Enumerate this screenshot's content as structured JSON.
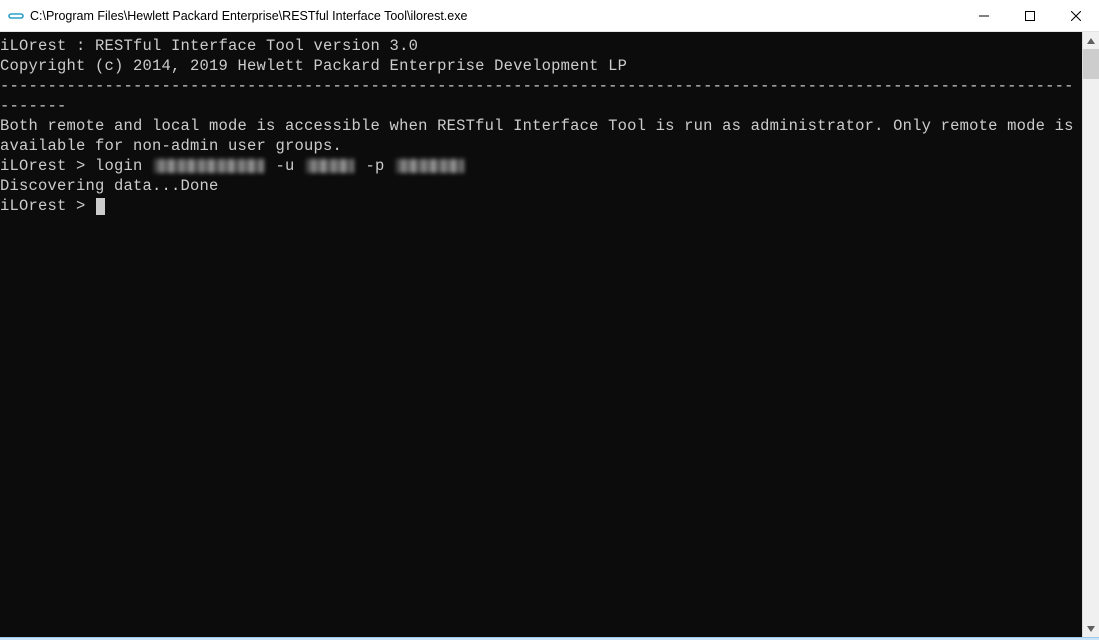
{
  "window": {
    "title": "C:\\Program Files\\Hewlett Packard Enterprise\\RESTful Interface Tool\\ilorest.exe"
  },
  "terminal": {
    "banner_line1": "iLOrest : RESTful Interface Tool version 3.0",
    "banner_line2": "Copyright (c) 2014, 2019 Hewlett Packard Enterprise Development LP",
    "separator": "------------------------------------------------------------------------------------------------------------------------",
    "info_line": "Both remote and local mode is accessible when RESTful Interface Tool is run as administrator. Only remote mode is available for non-admin user groups.",
    "prompt1_prefix": "iLOrest > login ",
    "login_host_redacted_width": 110,
    "login_flag_u": " -u ",
    "login_user_redacted_width": 48,
    "login_flag_p": " -p ",
    "login_pass_redacted_width": 68,
    "discover_line": "Discovering data...Done",
    "prompt2": "iLOrest > "
  }
}
